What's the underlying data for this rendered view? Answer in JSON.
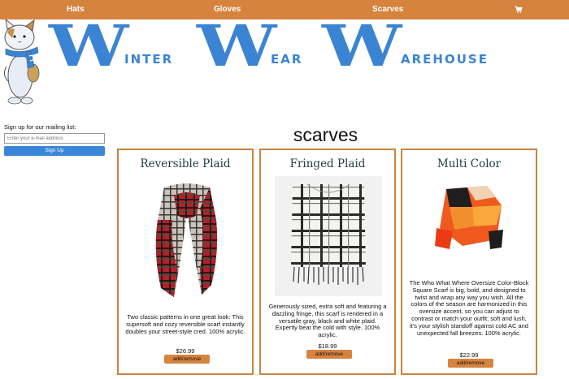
{
  "nav": {
    "items": [
      {
        "label": "Hats"
      },
      {
        "label": "Gloves"
      },
      {
        "label": "Scarves"
      }
    ],
    "cart_icon": "cart-icon"
  },
  "banner": {
    "words": [
      {
        "initial": "W",
        "rest": "INTER"
      },
      {
        "initial": "W",
        "rest": "EAR"
      },
      {
        "initial": "W",
        "rest": "AREHOUSE"
      }
    ],
    "color": "#3b84d3"
  },
  "mailing": {
    "label": "Sign up for our mailing list:",
    "placeholder": "Enter your e-mail address",
    "button": "Sign Up"
  },
  "page": {
    "title": "scarves"
  },
  "products": [
    {
      "title": "Reversible Plaid",
      "description": "Two classic patterns in one great look: This supersoft and cozy reversible scarf instantly doubles your street-style cred. 100% acrylic.",
      "price": "$26.99",
      "button": "add/remove"
    },
    {
      "title": "Fringed Plaid",
      "description": "Generously sized, extra soft and featuring a dazzling fringe, this scarf is rendered in a versatile gray, black and white plaid. Expertly beat the cold with style. 100% acrylic.",
      "price": "$18.99",
      "button": "add/remove"
    },
    {
      "title": "Multi Color",
      "description": "The Who What Where Oversize Color-Block Square Scarf is big, bold, and designed to twist and wrap any way you wish. All the colors of the season are harmonized in this oversize accent, so you can adjust to contrast or match your outfit; soft and lush, it's your stylish standoff against cold AC and unexpected fall breezes. 100% acrylic.",
      "price": "$22.99",
      "button": "add/remove"
    }
  ],
  "colors": {
    "accent": "#d6833e",
    "card_border": "#c9843f",
    "signup": "#3a86d8"
  }
}
